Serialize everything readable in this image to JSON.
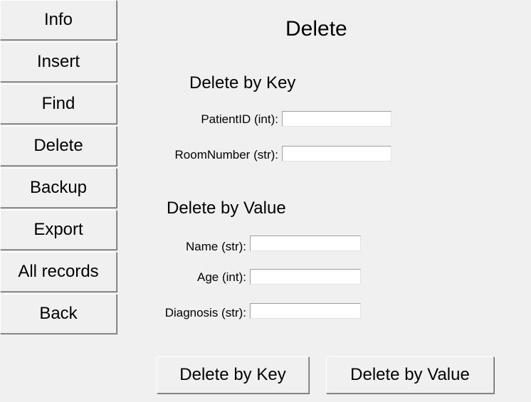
{
  "sidebar": {
    "items": [
      {
        "label": "Info"
      },
      {
        "label": "Insert"
      },
      {
        "label": "Find"
      },
      {
        "label": "Delete"
      },
      {
        "label": "Backup"
      },
      {
        "label": "Export"
      },
      {
        "label": "All records"
      },
      {
        "label": "Back"
      }
    ]
  },
  "main": {
    "title": "Delete",
    "by_key": {
      "heading": "Delete by Key",
      "fields": [
        {
          "label": "PatientID (int):",
          "value": ""
        },
        {
          "label": "RoomNumber (str):",
          "value": ""
        }
      ]
    },
    "by_value": {
      "heading": "Delete by Value",
      "fields": [
        {
          "label": "Name (str):",
          "value": ""
        },
        {
          "label": "Age (int):",
          "value": ""
        },
        {
          "label": "Diagnosis (str):",
          "value": ""
        }
      ]
    },
    "buttons": {
      "delete_by_key": "Delete by Key",
      "delete_by_value": "Delete by Value"
    }
  }
}
